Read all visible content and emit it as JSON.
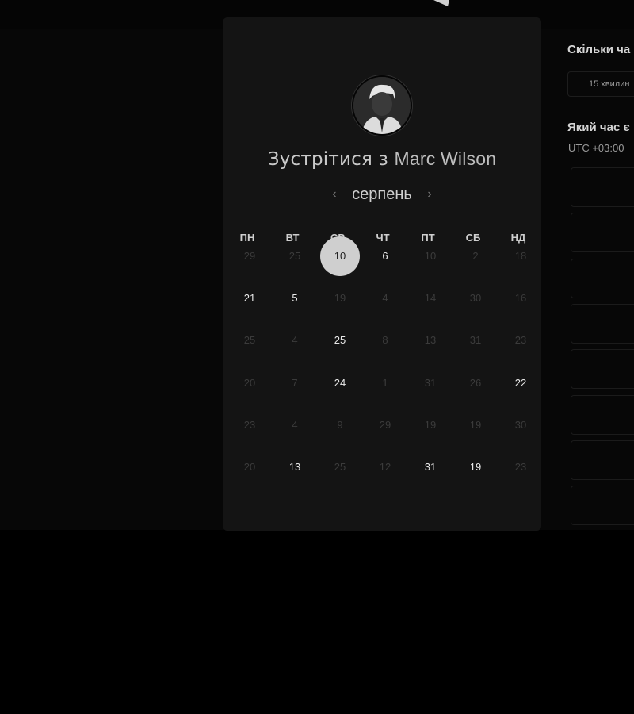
{
  "booking": {
    "heading_prefix": "Зустрітися з",
    "host_name": "Marc Wilson"
  },
  "calendar": {
    "month": "серпень",
    "prev_label": "‹",
    "next_label": "›",
    "weekdays": [
      "ПН",
      "ВТ",
      "СР",
      "ЧТ",
      "ПТ",
      "СБ",
      "НД"
    ],
    "weeks": [
      [
        {
          "d": "29",
          "s": "off"
        },
        {
          "d": "25",
          "s": "off"
        },
        {
          "d": "10",
          "s": "sel"
        },
        {
          "d": "6",
          "s": "on"
        },
        {
          "d": "10",
          "s": "off"
        },
        {
          "d": "2",
          "s": "off"
        },
        {
          "d": "18",
          "s": "off"
        }
      ],
      [
        {
          "d": "21",
          "s": "on"
        },
        {
          "d": "5",
          "s": "on"
        },
        {
          "d": "19",
          "s": "off"
        },
        {
          "d": "4",
          "s": "off"
        },
        {
          "d": "14",
          "s": "off"
        },
        {
          "d": "30",
          "s": "off"
        },
        {
          "d": "16",
          "s": "off"
        }
      ],
      [
        {
          "d": "25",
          "s": "off"
        },
        {
          "d": "4",
          "s": "off"
        },
        {
          "d": "25",
          "s": "on"
        },
        {
          "d": "8",
          "s": "off"
        },
        {
          "d": "13",
          "s": "off"
        },
        {
          "d": "31",
          "s": "off"
        },
        {
          "d": "23",
          "s": "off"
        }
      ],
      [
        {
          "d": "20",
          "s": "off"
        },
        {
          "d": "7",
          "s": "off"
        },
        {
          "d": "24",
          "s": "on"
        },
        {
          "d": "1",
          "s": "off"
        },
        {
          "d": "31",
          "s": "off"
        },
        {
          "d": "26",
          "s": "off"
        },
        {
          "d": "22",
          "s": "on"
        }
      ],
      [
        {
          "d": "23",
          "s": "off"
        },
        {
          "d": "4",
          "s": "off"
        },
        {
          "d": "9",
          "s": "off"
        },
        {
          "d": "29",
          "s": "off"
        },
        {
          "d": "19",
          "s": "off"
        },
        {
          "d": "19",
          "s": "off"
        },
        {
          "d": "30",
          "s": "off"
        }
      ],
      [
        {
          "d": "20",
          "s": "off"
        },
        {
          "d": "13",
          "s": "on"
        },
        {
          "d": "25",
          "s": "off"
        },
        {
          "d": "12",
          "s": "off"
        },
        {
          "d": "31",
          "s": "on"
        },
        {
          "d": "19",
          "s": "on"
        },
        {
          "d": "23",
          "s": "off"
        }
      ]
    ]
  },
  "side": {
    "duration_title": "Скільки ча",
    "duration_value": "15 хвилин",
    "time_title": "Який час є",
    "timezone": "UTC +03:00",
    "slot_count": 8
  }
}
